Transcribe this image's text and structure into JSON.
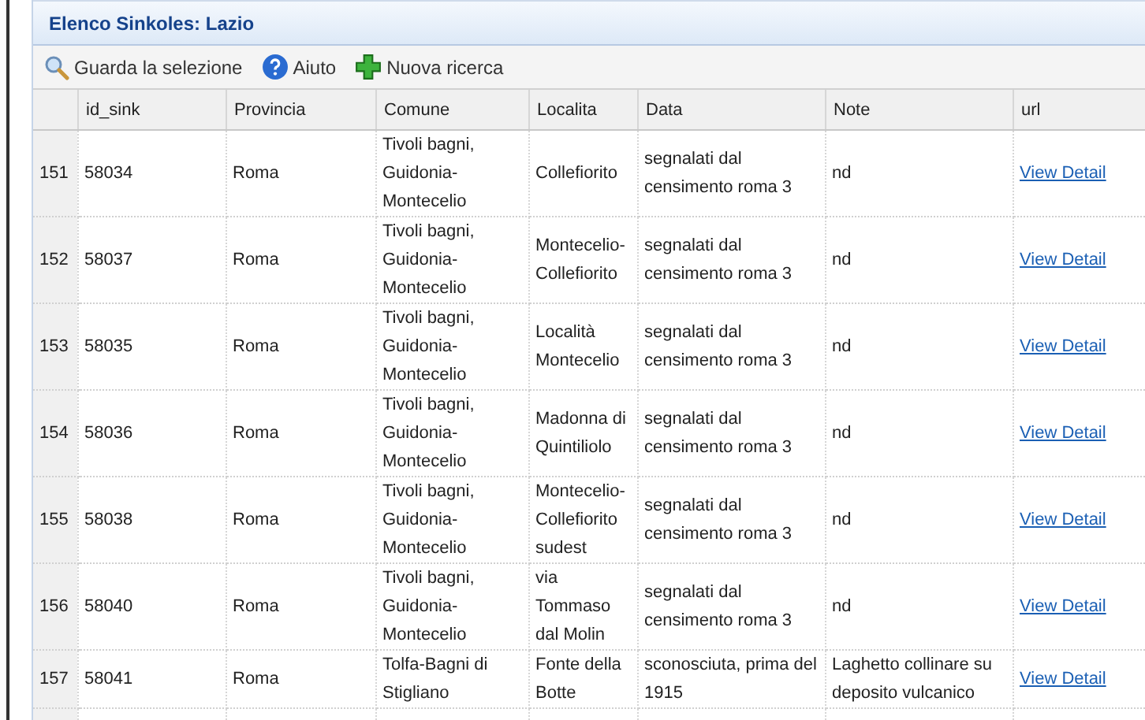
{
  "panel": {
    "title": "Elenco Sinkoles: Lazio"
  },
  "toolbar": [
    {
      "kind": "search",
      "label": "Guarda la selezione"
    },
    {
      "kind": "help",
      "label": "Aiuto"
    },
    {
      "kind": "add",
      "label": "Nuova ricerca"
    }
  ],
  "table": {
    "columns": [
      "id_sink",
      "Provincia",
      "Comune",
      "Localita",
      "Data",
      "Note",
      "url"
    ],
    "rows": [
      {
        "number": "151",
        "cells": [
          "58034",
          "Roma",
          "Tivoli bagni, Guidonia-Montecelio",
          "Collefiorito",
          "segnalati dal censimento roma 3",
          "nd"
        ],
        "link": "View Detail"
      },
      {
        "number": "152",
        "cells": [
          "58037",
          "Roma",
          "Tivoli bagni, Guidonia-Montecelio",
          "Montecelio-Collefiorito",
          "segnalati dal censimento roma 3",
          "nd"
        ],
        "link": "View Detail"
      },
      {
        "number": "153",
        "cells": [
          "58035",
          "Roma",
          "Tivoli bagni, Guidonia-Montecelio",
          "Località Montecelio",
          "segnalati dal censimento roma 3",
          "nd"
        ],
        "link": "View Detail"
      },
      {
        "number": "154",
        "cells": [
          "58036",
          "Roma",
          "Tivoli bagni, Guidonia-Montecelio",
          "Madonna di Quintiliolo",
          "segnalati dal censimento roma 3",
          "nd"
        ],
        "link": "View Detail"
      },
      {
        "number": "155",
        "cells": [
          "58038",
          "Roma",
          "Tivoli bagni, Guidonia-Montecelio",
          "Montecelio-Collefiorito sudest",
          "segnalati dal censimento roma 3",
          "nd"
        ],
        "link": "View Detail"
      },
      {
        "number": "156",
        "cells": [
          "58040",
          "Roma",
          "Tivoli bagni, Guidonia-Montecelio",
          "via Tommaso dal Molin",
          "segnalati dal censimento roma 3",
          "nd"
        ],
        "link": "View Detail"
      },
      {
        "number": "157",
        "cells": [
          "58041",
          "Roma",
          "Tolfa-Bagni di Stigliano",
          "Fonte della Botte",
          "sconosciuta, prima del 1915",
          "Laghetto collinare su deposito vulcanico"
        ],
        "link": "View Detail"
      }
    ]
  }
}
